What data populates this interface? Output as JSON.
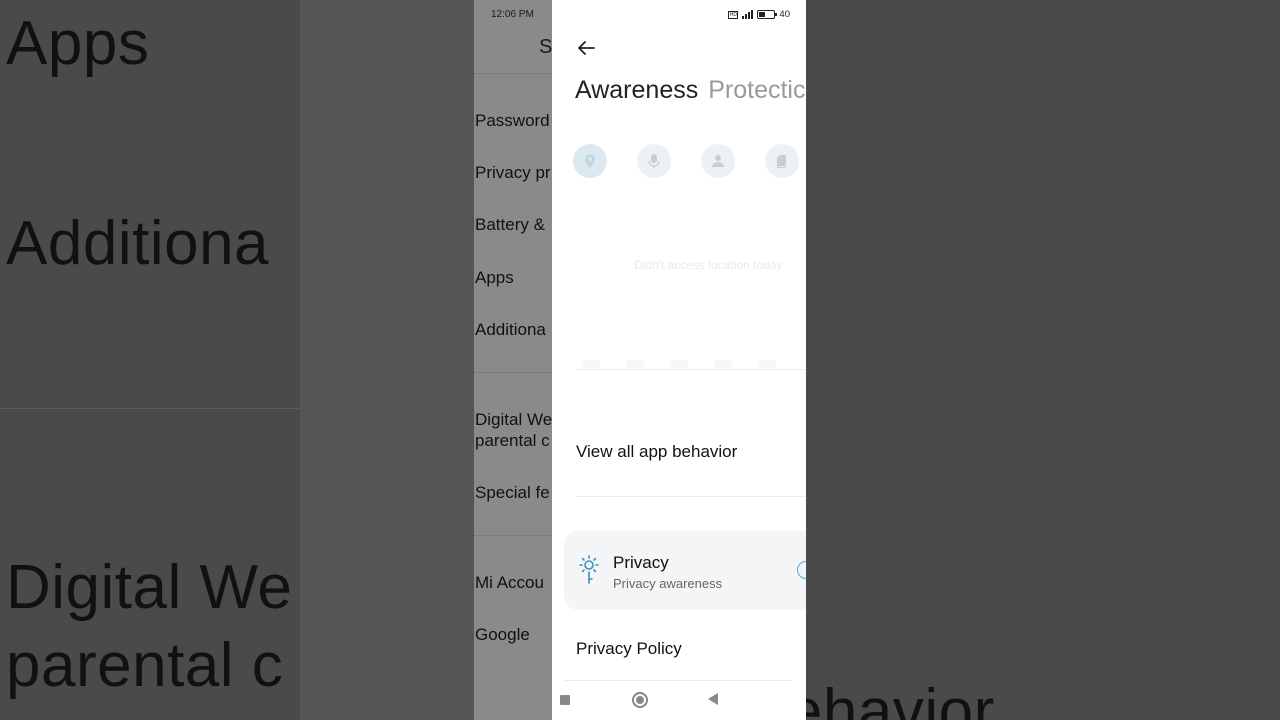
{
  "background": {
    "left_texts": [
      "Apps",
      "Additiona",
      "Digital We",
      "parental c"
    ],
    "right_texts": [
      "View all app behavior"
    ]
  },
  "settings": {
    "time": "12:06 PM",
    "title": "S",
    "items": [
      "Password",
      "Privacy pr",
      "Battery &",
      "Apps",
      "Additiona",
      "Digital We",
      "parental c",
      "Special fe",
      "Mi Accou",
      "Google"
    ]
  },
  "status": {
    "battery": "40"
  },
  "header": {
    "back_icon": "arrow-left-icon"
  },
  "tabs": [
    {
      "label": "Awareness",
      "active": true
    },
    {
      "label": "Protectic",
      "active": false
    }
  ],
  "permissions": [
    {
      "icon": "location-icon",
      "active": true
    },
    {
      "icon": "microphone-icon",
      "active": false
    },
    {
      "icon": "contacts-icon",
      "active": false
    },
    {
      "icon": "storage-icon",
      "active": false
    }
  ],
  "empty_message": "Didn't access location today",
  "view_all_label": "View all app behavior",
  "privacy_card": {
    "title": "Privacy",
    "subtitle": "Privacy awareness",
    "accent": "#3d8fc5"
  },
  "privacy_policy_label": "Privacy Policy"
}
